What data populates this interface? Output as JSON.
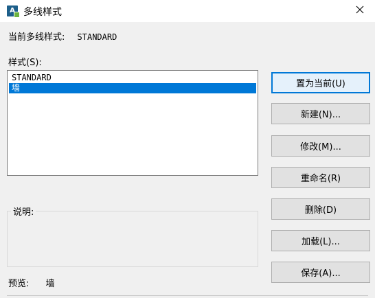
{
  "window": {
    "title": "多线样式",
    "close_glyph": "✕"
  },
  "app_icon_text": "A",
  "current": {
    "label": "当前多线样式:",
    "value": "STANDARD"
  },
  "styles": {
    "label": "样式(S):",
    "items": [
      {
        "text": "STANDARD",
        "selected": false
      },
      {
        "text": "墙",
        "selected": true
      }
    ]
  },
  "buttons": {
    "set_current": "置为当前(U)",
    "new": "新建(N)...",
    "modify": "修改(M)...",
    "rename": "重命名(R)",
    "delete": "删除(D)",
    "load": "加载(L)...",
    "save": "保存(A)..."
  },
  "description": {
    "label": "说明:",
    "text": ""
  },
  "preview": {
    "label": "预览:",
    "value": "墙"
  },
  "colors": {
    "selection": "#0078d7",
    "primary_border": "#0078d7"
  }
}
